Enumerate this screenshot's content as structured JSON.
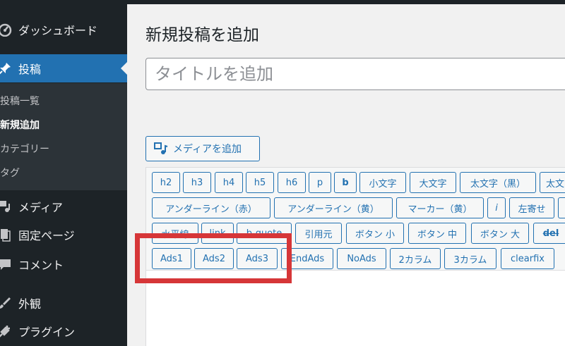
{
  "sidebar": {
    "items": [
      {
        "label": "ダッシュボード",
        "icon": "dashboard-icon"
      },
      {
        "label": "投稿",
        "icon": "pin-icon"
      },
      {
        "label": "メディア",
        "icon": "media-icon"
      },
      {
        "label": "固定ページ",
        "icon": "page-icon"
      },
      {
        "label": "コメント",
        "icon": "comment-icon"
      },
      {
        "label": "外観",
        "icon": "brush-icon"
      },
      {
        "label": "プラグイン",
        "icon": "plugin-icon"
      }
    ],
    "submenu": [
      "投稿一覧",
      "新規追加",
      "カテゴリー",
      "タグ"
    ]
  },
  "main": {
    "title": "新規投稿を追加",
    "title_placeholder": "タイトルを追加",
    "add_media_label": "メディアを追加"
  },
  "toolbar": {
    "row1": [
      "h2",
      "h3",
      "h4",
      "h5",
      "h6",
      "p",
      "b",
      "小文字",
      "大文字",
      "太文字（黒）",
      "太文"
    ],
    "row2": [
      "アンダーライン（赤）",
      "アンダーライン（黄）",
      "マーカー（黄）",
      "i",
      "左寄せ",
      ""
    ],
    "row3": [
      "水平線",
      "link",
      "b-quote",
      "引用元",
      "ボタン 小",
      "ボタン 中",
      "ボタン 大",
      "del"
    ],
    "row4": [
      "Ads1",
      "Ads2",
      "Ads3",
      "EndAds",
      "NoAds",
      "2カラム",
      "3カラム",
      "clearfix"
    ]
  },
  "colors": {
    "accent": "#2271b1",
    "sidebar_bg": "#1d2327",
    "highlight": "#d63638"
  }
}
